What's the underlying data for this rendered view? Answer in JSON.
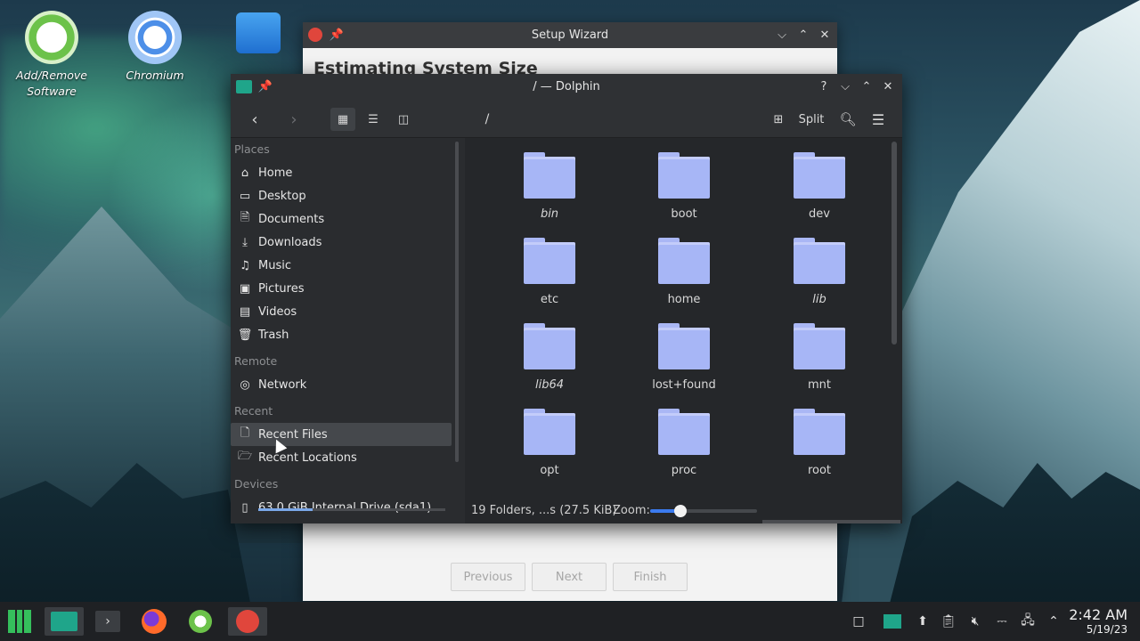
{
  "desktop": {
    "icons": [
      {
        "label": "Add/Remove Software"
      },
      {
        "label": "Chromium"
      }
    ]
  },
  "wizard": {
    "title": "Setup Wizard",
    "heading": "Estimating System Size",
    "buttons": {
      "previous": "Previous",
      "next": "Next",
      "finish": "Finish"
    }
  },
  "dolphin": {
    "title": "/ — Dolphin",
    "path": "/",
    "split_label": "Split",
    "places_header": "Places",
    "places": [
      "Home",
      "Desktop",
      "Documents",
      "Downloads",
      "Music",
      "Pictures",
      "Videos",
      "Trash"
    ],
    "remote_header": "Remote",
    "remote": [
      "Network"
    ],
    "recent_header": "Recent",
    "recent": [
      "Recent Files",
      "Recent Locations"
    ],
    "devices_header": "Devices",
    "devices": [
      "63.0 GiB Internal Drive (sda1)"
    ],
    "device_usage_fraction": 0.29,
    "folders": [
      {
        "name": "bin",
        "italic": true
      },
      {
        "name": "boot",
        "italic": false
      },
      {
        "name": "dev",
        "italic": false
      },
      {
        "name": "etc",
        "italic": false
      },
      {
        "name": "home",
        "italic": false
      },
      {
        "name": "lib",
        "italic": true
      },
      {
        "name": "lib64",
        "italic": true
      },
      {
        "name": "lost+found",
        "italic": false
      },
      {
        "name": "mnt",
        "italic": false
      },
      {
        "name": "opt",
        "italic": false
      },
      {
        "name": "proc",
        "italic": false
      },
      {
        "name": "root",
        "italic": false
      }
    ],
    "status_text": "19 Folders, ...s (27.5 KiB)",
    "zoom_label": "Zoom:",
    "zoom_fraction": 0.27
  },
  "taskbar": {
    "time": "2:42 AM",
    "date": "5/19/23"
  },
  "colors": {
    "folder": "#a7b6f6",
    "accent": "#3b7bf0",
    "window_bg": "#2a2c2f"
  }
}
